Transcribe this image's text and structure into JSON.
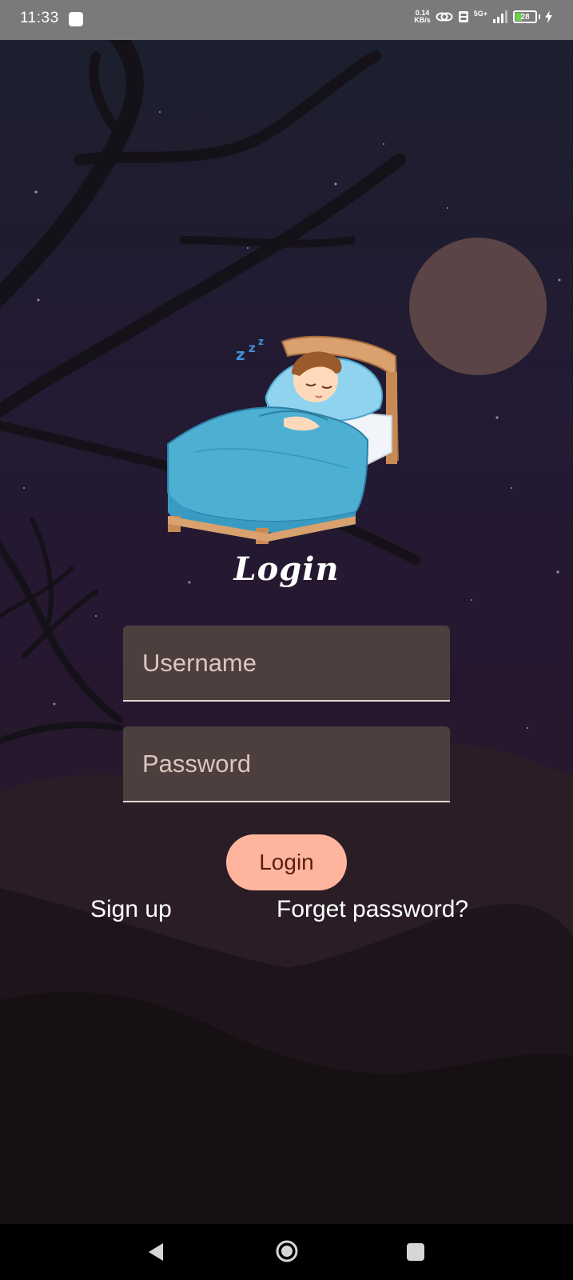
{
  "status_bar": {
    "time": "11:33",
    "net_speed_value": "0.14",
    "net_speed_unit": "KB/s",
    "network_type": "5G+",
    "battery_level": "28"
  },
  "screen": {
    "title": "Login",
    "username_placeholder": "Username",
    "password_placeholder": "Password",
    "login_button": "Login",
    "signup_link": "Sign up",
    "forgot_link": "Forget password?"
  },
  "colors": {
    "status_bar": "#7a7a7a",
    "moon": "#5a4446",
    "field_bg": "#4d3f3e",
    "button_bg": "#ffb59d",
    "button_text": "#5a1e10"
  },
  "icons": {
    "back": "nav-back-icon",
    "home": "nav-home-icon",
    "recents": "nav-recents-icon",
    "sleeping_boy": "sleeping-boy-illustration"
  }
}
